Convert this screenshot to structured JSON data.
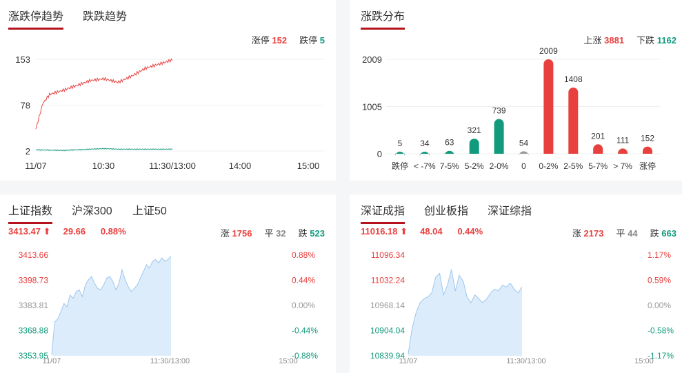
{
  "colors": {
    "up": "#e8403f",
    "down": "#119a7c",
    "flat": "#999999",
    "accent": "#b5121b",
    "area": "#ddecfb",
    "area_line": "#9cc7ef"
  },
  "limit_panel": {
    "tabs": [
      "涨跌停趋势",
      "跌跌趋势"
    ],
    "summary": {
      "up_label": "涨停",
      "up_value": "152",
      "down_label": "跌停",
      "down_value": "5"
    },
    "y_ticks": [
      "153",
      "78",
      "2"
    ],
    "x_ticks": [
      "11/07",
      "10:30",
      "11:30/13:00",
      "14:00",
      "15:00"
    ]
  },
  "dist_panel": {
    "tabs": [
      "涨跌分布"
    ],
    "summary": {
      "up_label": "上涨",
      "up_value": "3881",
      "down_label": "下跌",
      "down_value": "1162"
    },
    "y_ticks": [
      "2009",
      "1005",
      "0"
    ]
  },
  "sh_panel": {
    "tabs": [
      "上证指数",
      "沪深300",
      "上证50"
    ],
    "price": "3413.47",
    "arrow": "⬆",
    "change": "29.66",
    "pct": "0.88%",
    "up_label": "涨",
    "up_count": "1756",
    "flat_label": "平",
    "flat_count": "32",
    "down_label": "跌",
    "down_count": "523",
    "y_left": [
      "3413.66",
      "3398.73",
      "3383.81",
      "3368.88",
      "3353.95"
    ],
    "y_right": [
      "0.88%",
      "0.44%",
      "0.00%",
      "-0.44%",
      "-0.88%"
    ],
    "x_ticks": [
      "11/07",
      "11:30/13:00",
      "15:00"
    ]
  },
  "sz_panel": {
    "tabs": [
      "深证成指",
      "创业板指",
      "深证综指"
    ],
    "price": "11016.18",
    "arrow": "⬆",
    "change": "48.04",
    "pct": "0.44%",
    "up_label": "涨",
    "up_count": "2173",
    "flat_label": "平",
    "flat_count": "44",
    "down_label": "跌",
    "down_count": "663",
    "y_left": [
      "11096.34",
      "11032.24",
      "10968.14",
      "10904.04",
      "10839.94"
    ],
    "y_right": [
      "1.17%",
      "0.59%",
      "0.00%",
      "-0.58%",
      "-1.17%"
    ],
    "x_ticks": [
      "11/07",
      "11:30/13:00",
      "15:00"
    ]
  },
  "chart_data": [
    {
      "type": "line",
      "title": "涨跌停趋势",
      "ylim": [
        2,
        153
      ],
      "series": [
        {
          "name": "涨停",
          "x": [
            0,
            0.05,
            0.1,
            0.2,
            0.3,
            0.4,
            0.5,
            0.6,
            0.7,
            0.8,
            0.9,
            1.0
          ],
          "values": [
            38,
            80,
            95,
            102,
            110,
            118,
            121,
            115,
            125,
            138,
            145,
            152
          ]
        },
        {
          "name": "跌停",
          "x": [
            0,
            0.2,
            0.4,
            0.5,
            0.6,
            0.8,
            1.0
          ],
          "values": [
            4,
            3,
            5,
            6,
            5,
            5,
            5
          ]
        }
      ],
      "x_ticks": [
        "11/07",
        "10:30",
        "11:30/13:00",
        "14:00",
        "15:00"
      ]
    },
    {
      "type": "bar",
      "title": "涨跌分布",
      "ylim": [
        0,
        2009
      ],
      "categories": [
        "跌停",
        "< -7%",
        "7-5%",
        "5-2%",
        "2-0%",
        "0",
        "0-2%",
        "2-5%",
        "5-7%",
        "> 7%",
        "涨停"
      ],
      "values": [
        5,
        34,
        63,
        321,
        739,
        54,
        2009,
        1408,
        201,
        111,
        152
      ],
      "colors": [
        "#119a7c",
        "#119a7c",
        "#119a7c",
        "#119a7c",
        "#119a7c",
        "#999999",
        "#e8403f",
        "#e8403f",
        "#e8403f",
        "#e8403f",
        "#e8403f"
      ]
    },
    {
      "type": "area",
      "title": "上证指数",
      "ylim": [
        3353.95,
        3413.66
      ],
      "values": [
        3355,
        3374,
        3376,
        3380,
        3385,
        3383,
        3390,
        3388,
        3392,
        3393,
        3389,
        3396,
        3399,
        3401,
        3397,
        3394,
        3393,
        3396,
        3400,
        3401,
        3398,
        3393,
        3397,
        3405,
        3399,
        3395,
        3392,
        3394,
        3396,
        3400,
        3404,
        3408,
        3406,
        3410,
        3411,
        3409,
        3412,
        3410,
        3411,
        3413
      ]
    },
    {
      "type": "area",
      "title": "深证成指",
      "ylim": [
        10839.94,
        11096.34
      ],
      "values": [
        10845,
        10910,
        10950,
        10975,
        10985,
        10990,
        11000,
        11040,
        11050,
        10995,
        11020,
        11060,
        11005,
        11045,
        11030,
        10990,
        10975,
        10995,
        10985,
        10975,
        10985,
        11000,
        11010,
        11005,
        11020,
        11015,
        11025,
        11010,
        11000,
        11015
      ]
    }
  ]
}
